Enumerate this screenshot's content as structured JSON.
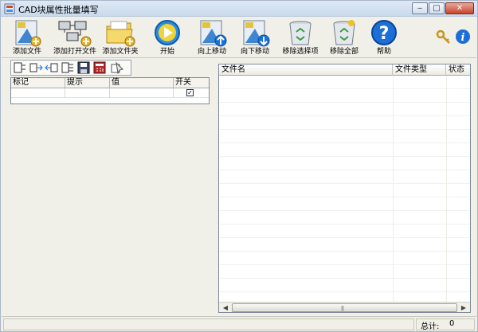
{
  "window": {
    "title": "CAD块属性批量填写",
    "minimize_label": "‒",
    "maximize_label": "□",
    "close_label": "✕"
  },
  "toolbar": {
    "buttons": [
      {
        "label": "添加文件",
        "icon": "add-file-icon"
      },
      {
        "label": "添加打开文件",
        "icon": "add-open-file-icon"
      },
      {
        "label": "添加文件夹",
        "icon": "add-folder-icon"
      },
      {
        "label": "开始",
        "icon": "play-icon"
      },
      {
        "label": "向上移动",
        "icon": "move-up-icon"
      },
      {
        "label": "向下移动",
        "icon": "move-down-icon"
      },
      {
        "label": "移除选择项",
        "icon": "recycle-bin-icon"
      },
      {
        "label": "移除全部",
        "icon": "recycle-bin-all-icon"
      },
      {
        "label": "帮助",
        "icon": "help-icon"
      }
    ],
    "extra_icons": [
      "key-icon",
      "info-icon"
    ]
  },
  "attributes_grid": {
    "toolbar_icons": [
      "select-block-icon",
      "insert-row-icon",
      "delete-row-icon",
      "edit-row-icon",
      "save-icon",
      "calculator-icon",
      "pick-icon"
    ],
    "columns": [
      "标记",
      "提示",
      "值",
      "开关"
    ],
    "rows": [
      {
        "tag": "",
        "prompt": "",
        "value": "",
        "switch": "✓"
      }
    ]
  },
  "file_list": {
    "columns": [
      "文件名",
      "文件类型",
      "状态"
    ],
    "rows": []
  },
  "status": {
    "total_label": "总计:",
    "total_value": "0"
  },
  "colors": {
    "window_bg": "#f0efe8",
    "accent_blue": "#1a73d9"
  }
}
